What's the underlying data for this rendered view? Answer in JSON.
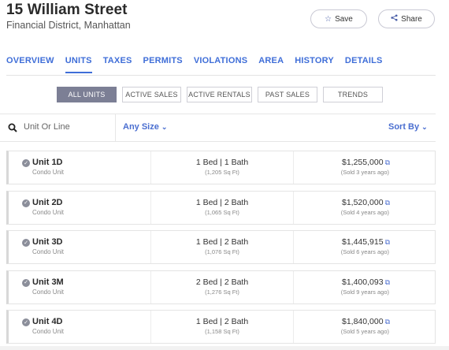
{
  "header": {
    "title": "15 William Street",
    "subtitle": "Financial District, Manhattan",
    "save_label": "Save",
    "share_label": "Share"
  },
  "tabs": [
    {
      "label": "OVERVIEW",
      "active": false
    },
    {
      "label": "UNITS",
      "active": true
    },
    {
      "label": "TAXES",
      "active": false
    },
    {
      "label": "PERMITS",
      "active": false
    },
    {
      "label": "VIOLATIONS",
      "active": false
    },
    {
      "label": "AREA",
      "active": false
    },
    {
      "label": "HISTORY",
      "active": false
    },
    {
      "label": "DETAILS",
      "active": false
    }
  ],
  "filters": [
    {
      "label": "ALL UNITS",
      "active": true
    },
    {
      "label": "ACTIVE SALES",
      "active": false
    },
    {
      "label": "ACTIVE RENTALS",
      "active": false
    },
    {
      "label": "PAST SALES",
      "active": false
    },
    {
      "label": "TRENDS",
      "active": false
    }
  ],
  "toolbar": {
    "search_placeholder": "Unit Or Line",
    "size_label": "Any Size",
    "sort_label": "Sort By"
  },
  "units": [
    {
      "name": "Unit 1D",
      "type": "Condo Unit",
      "beds_baths": "1 Bed | 1 Bath",
      "sqft": "(1,205 Sq Ft)",
      "price": "$1,255,000",
      "sold": "(Sold 3 years ago)"
    },
    {
      "name": "Unit 2D",
      "type": "Condo Unit",
      "beds_baths": "1 Bed | 2 Bath",
      "sqft": "(1,065 Sq Ft)",
      "price": "$1,520,000",
      "sold": "(Sold 4 years ago)"
    },
    {
      "name": "Unit 3D",
      "type": "Condo Unit",
      "beds_baths": "1 Bed | 2 Bath",
      "sqft": "(1,076 Sq Ft)",
      "price": "$1,445,915",
      "sold": "(Sold 6 years ago)"
    },
    {
      "name": "Unit 3M",
      "type": "Condo Unit",
      "beds_baths": "2 Bed | 2 Bath",
      "sqft": "(1,276 Sq Ft)",
      "price": "$1,400,093",
      "sold": "(Sold 9 years ago)"
    },
    {
      "name": "Unit 4D",
      "type": "Condo Unit",
      "beds_baths": "1 Bed | 2 Bath",
      "sqft": "(1,158 Sq Ft)",
      "price": "$1,840,000",
      "sold": "(Sold 5 years ago)"
    }
  ],
  "colors": {
    "accent": "#3f6ed8",
    "active_filter": "#7c7f95"
  }
}
